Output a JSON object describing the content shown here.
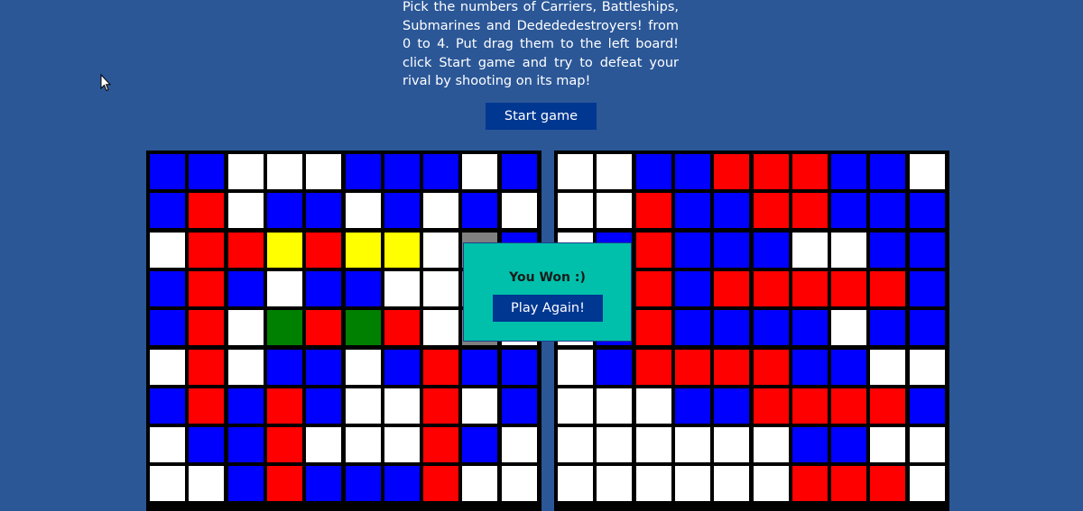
{
  "instructions": "Pick the numbers of Carriers, Battleships, Submarines and Dedededestroyers! from 0 to 4. Put drag them to the left board! click Start game and try to defeat your rival by shooting on its map!",
  "start_button_label": "Start game",
  "result": {
    "message": "You Won :)",
    "play_again_label": "Play Again!"
  },
  "colors": {
    "background": "#2b5797",
    "button": "#003791",
    "dialog": "#00c0ab",
    "B": "#0000ff",
    "W": "#ffffff",
    "R": "#ff0000",
    "Y": "#ffff00",
    "G": "#008000",
    "S": "#808080"
  },
  "legend": {
    "B": "blue",
    "W": "white",
    "R": "red",
    "Y": "yellow",
    "G": "green",
    "S": "gray"
  },
  "boards": {
    "left": [
      [
        "B",
        "B",
        "W",
        "W",
        "W",
        "B",
        "B",
        "B",
        "W",
        "B"
      ],
      [
        "B",
        "R",
        "W",
        "B",
        "B",
        "W",
        "B",
        "W",
        "B",
        "W"
      ],
      [
        "W",
        "R",
        "R",
        "Y",
        "R",
        "Y",
        "Y",
        "W",
        "S",
        "B"
      ],
      [
        "B",
        "R",
        "B",
        "W",
        "B",
        "B",
        "W",
        "W",
        "S",
        "B"
      ],
      [
        "B",
        "R",
        "W",
        "G",
        "R",
        "G",
        "R",
        "W",
        "S",
        "W"
      ],
      [
        "W",
        "R",
        "W",
        "B",
        "B",
        "W",
        "B",
        "R",
        "B",
        "B"
      ],
      [
        "B",
        "R",
        "B",
        "R",
        "B",
        "W",
        "W",
        "R",
        "W",
        "B"
      ],
      [
        "W",
        "B",
        "B",
        "R",
        "W",
        "W",
        "W",
        "R",
        "B",
        "W"
      ],
      [
        "W",
        "W",
        "B",
        "R",
        "B",
        "B",
        "B",
        "R",
        "W",
        "W"
      ]
    ],
    "right": [
      [
        "W",
        "W",
        "B",
        "B",
        "R",
        "R",
        "R",
        "B",
        "B",
        "W"
      ],
      [
        "W",
        "W",
        "R",
        "B",
        "B",
        "R",
        "R",
        "B",
        "B",
        "B"
      ],
      [
        "W",
        "B",
        "R",
        "B",
        "B",
        "B",
        "W",
        "W",
        "B",
        "B"
      ],
      [
        "W",
        "B",
        "R",
        "B",
        "R",
        "R",
        "R",
        "R",
        "R",
        "B"
      ],
      [
        "W",
        "B",
        "R",
        "B",
        "B",
        "B",
        "B",
        "W",
        "B",
        "B"
      ],
      [
        "W",
        "B",
        "R",
        "R",
        "R",
        "R",
        "B",
        "B",
        "W",
        "W"
      ],
      [
        "W",
        "W",
        "W",
        "B",
        "B",
        "R",
        "R",
        "R",
        "R",
        "B"
      ],
      [
        "W",
        "W",
        "W",
        "W",
        "W",
        "W",
        "B",
        "B",
        "W",
        "W"
      ],
      [
        "W",
        "W",
        "W",
        "W",
        "W",
        "W",
        "R",
        "R",
        "R",
        "W"
      ]
    ]
  }
}
